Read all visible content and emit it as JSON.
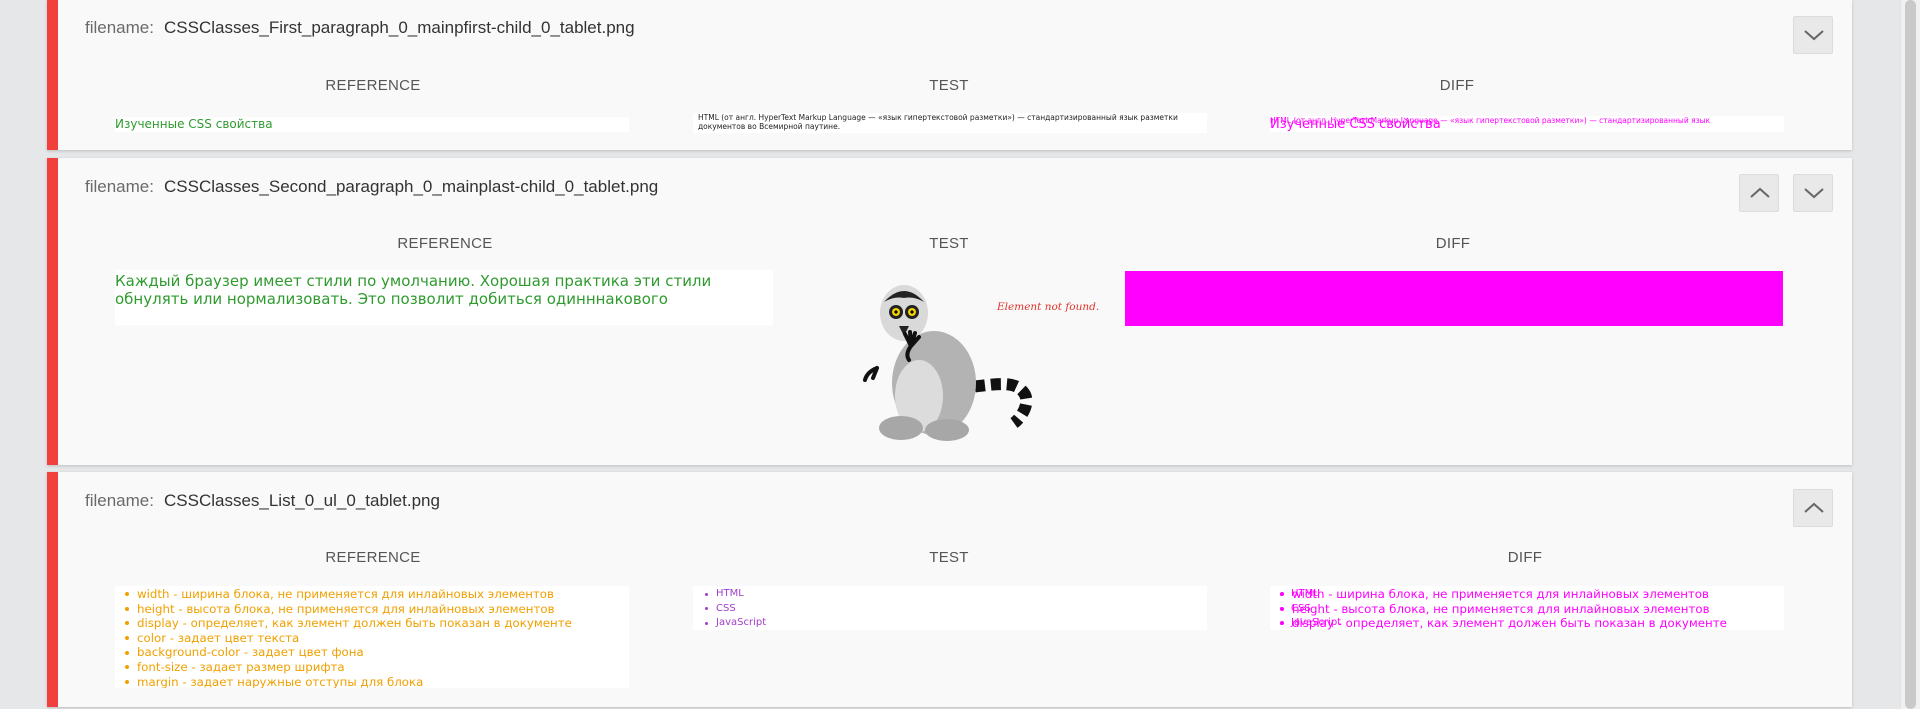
{
  "columns": {
    "reference": "REFERENCE",
    "test": "TEST",
    "diff": "DIFF"
  },
  "filename_label": "filename:",
  "cards": [
    {
      "filename": "CSSClasses_First_paragraph_0_mainpfirst-child_0_tablet.png",
      "reference_text": "Изученные CSS свойства",
      "test_text": "HTML (от англ. HyperText Markup Language — «язык гипертекстовой разметки») — стандартизированный язык разметки документов во Всемирной паутине.",
      "diff_text_a": "HTML (от англ. HyperText Markup Language — «язык гипертекстовой разметки») — стандартизированный язык",
      "diff_text_b": "Изученные CSS свойства"
    },
    {
      "filename": "CSSClasses_Second_paragraph_0_mainplast-child_0_tablet.png",
      "reference_text": "Каждый браузер имеет стили по умолчанию. Хорошая практика эти стили обнулять или нормализовать. Это позволит добиться одинннакового",
      "not_found": "Element not found."
    },
    {
      "filename": "CSSClasses_List_0_ul_0_tablet.png",
      "reference_items": [
        "width - ширина блока, не применяется для инлайновых элементов",
        "height - высота блока, не применяется для инлайновых элементов",
        "display - определяет, как элемент должен быть показан в документе",
        "color - задает цвет текста",
        "background-color - задает цвет фона",
        "font-size - задает размер шрифта",
        "margin - задает наружные отступы для блока"
      ],
      "test_items": [
        "HTML",
        "CSS",
        "JavaScript"
      ],
      "diff_items": [
        "width - ширина блока, не применяется для инлайновых элементов",
        "height - высота блока, не применяется для инлайновых элементов",
        "display - определяет, как элемент должен быть показан в документе"
      ]
    }
  ],
  "colors": {
    "accent": "#f0413c",
    "reference_green": "#2f9b2f",
    "reference_orange": "#f0a000",
    "test_purple": "#a040c8",
    "diff_magenta": "#ff00ff"
  }
}
